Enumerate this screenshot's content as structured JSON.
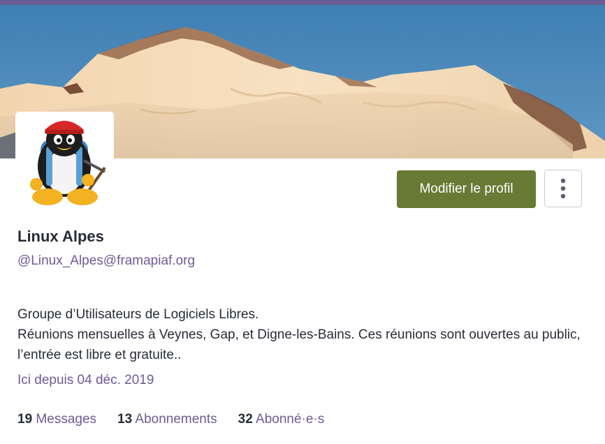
{
  "profile": {
    "display_name": "Linux Alpes",
    "handle": "@Linux_Alpes@framapiaf.org",
    "bio_line1": "Groupe d’Utilisateurs de Logiciels Libres.",
    "bio_line2": "Réunions mensuelles à Veynes, Gap, et Digne-les-Bains. Ces réunions sont ouvertes au public, l’entrée est libre et gratuite..",
    "joined": "Ici depuis 04 déc. 2019"
  },
  "actions": {
    "edit_label": "Modifier le profil",
    "more_icon": "vertical-ellipsis-icon"
  },
  "stats": [
    {
      "count": "19",
      "label": "Messages"
    },
    {
      "count": "13",
      "label": "Abonnements"
    },
    {
      "count": "32",
      "label": "Abonné·e·s"
    }
  ],
  "colors": {
    "accent": "#6d5b95",
    "primary_button": "#687a34",
    "sky": "#4d88b8"
  }
}
